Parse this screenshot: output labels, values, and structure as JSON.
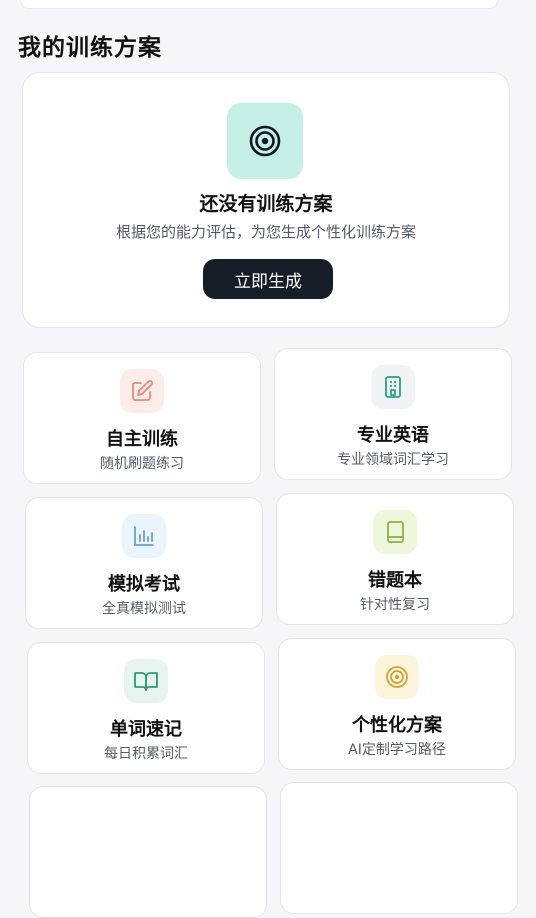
{
  "section_title": "我的训练方案",
  "plan": {
    "icon": "target-icon",
    "heading": "还没有训练方案",
    "description": "根据您的能力评估，为您生成个性化训练方案",
    "button_label": "立即生成"
  },
  "features": [
    {
      "title": "自主训练",
      "subtitle": "随机刷题练习",
      "icon": "edit-icon",
      "icon_bg": "#fdecea",
      "icon_color": "#ea8a76"
    },
    {
      "title": "专业英语",
      "subtitle": "专业领域词汇学习",
      "icon": "document-icon",
      "icon_bg": "#f2f3f5",
      "icon_color": "#27a37c"
    },
    {
      "title": "模拟考试",
      "subtitle": "全真模拟测试",
      "icon": "bar-chart-icon",
      "icon_bg": "#eaf4fd",
      "icon_color": "#6c9fc7"
    },
    {
      "title": "错题本",
      "subtitle": "针对性复习",
      "icon": "notebook-icon",
      "icon_bg": "#eef7d9",
      "icon_color": "#8cb24a"
    },
    {
      "title": "单词速记",
      "subtitle": "每日积累词汇",
      "icon": "open-book-icon",
      "icon_bg": "#e7f5f0",
      "icon_color": "#2c9a76"
    },
    {
      "title": "个性化方案",
      "subtitle": "AI定制学习路径",
      "icon": "target-icon",
      "icon_bg": "#fdf4dc",
      "icon_color": "#d4a32f"
    }
  ]
}
